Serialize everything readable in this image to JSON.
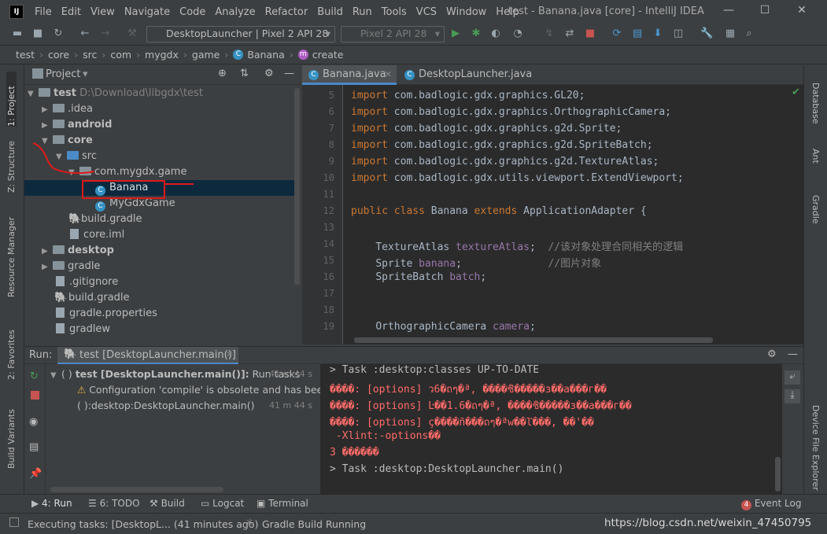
{
  "window": {
    "title": "test - Banana.java [core] - IntelliJ IDEA",
    "menu": [
      "File",
      "Edit",
      "View",
      "Navigate",
      "Code",
      "Analyze",
      "Refactor",
      "Build",
      "Run",
      "Tools",
      "VCS",
      "Window",
      "Help"
    ]
  },
  "toolbar": {
    "run_config": "DesktopLauncher | Pixel 2 API 28",
    "device": "Pixel 2 API 28"
  },
  "breadcrumb": [
    "test",
    "core",
    "src",
    "com",
    "mygdx",
    "game",
    "Banana",
    "create"
  ],
  "left_strip": [
    "1: Project",
    "Z: Structure",
    "Resource Manager",
    "2: Favorites",
    "Build Variants"
  ],
  "right_strip": [
    "Database",
    "Ant",
    "Gradle",
    "Device File Explorer"
  ],
  "project": {
    "header": "Project",
    "tree": [
      {
        "label": "test",
        "extra": "D:\\Download\\libgdx\\test"
      },
      {
        "label": ".idea"
      },
      {
        "label": "android"
      },
      {
        "label": "core"
      },
      {
        "label": "src"
      },
      {
        "label": "com.mygdx.game"
      },
      {
        "label": "Banana"
      },
      {
        "label": "MyGdxGame"
      },
      {
        "label": "build.gradle"
      },
      {
        "label": "core.iml"
      },
      {
        "label": "desktop"
      },
      {
        "label": "gradle"
      },
      {
        "label": ".gitignore"
      },
      {
        "label": "build.gradle"
      },
      {
        "label": "gradle.properties"
      },
      {
        "label": "gradlew"
      }
    ]
  },
  "editor": {
    "tabs": [
      "Banana.java",
      "DesktopLauncher.java"
    ],
    "line_numbers": [
      "5",
      "6",
      "7",
      "8",
      "9",
      "10",
      "11",
      "12",
      "13",
      "14",
      "15",
      "16",
      "17",
      "18",
      "19"
    ],
    "lines": [
      {
        "kw": "import ",
        "rest": "com.badlogic.gdx.graphics.GL20;"
      },
      {
        "kw": "import ",
        "rest": "com.badlogic.gdx.graphics.OrthographicCamera;"
      },
      {
        "kw": "import ",
        "rest": "com.badlogic.gdx.graphics.g2d.Sprite;"
      },
      {
        "kw": "import ",
        "rest": "com.badlogic.gdx.graphics.g2d.SpriteBatch;"
      },
      {
        "kw": "import ",
        "rest": "com.badlogic.gdx.graphics.g2d.TextureAtlas;"
      },
      {
        "kw": "import ",
        "rest": "com.badlogic.gdx.utils.viewport.ExtendViewport;"
      },
      {
        "kw": "",
        "rest": ""
      },
      {
        "kw": "public class ",
        "name": "Banana ",
        "kw2": "extends ",
        "rest": "ApplicationAdapter {"
      },
      {
        "kw": "",
        "rest": ""
      },
      {
        "type": "TextureAtlas ",
        "field": "textureAtlas",
        "rest": ";  ",
        "comment": "//该对象处理合同相关的逻辑"
      },
      {
        "type": "Sprite ",
        "field": "banana",
        "rest": ";              ",
        "comment": "//图片对象"
      },
      {
        "type": "SpriteBatch ",
        "field": "batch",
        "rest": ";",
        "comment": ""
      },
      {
        "kw": "",
        "rest": ""
      },
      {
        "kw": "",
        "rest": ""
      },
      {
        "type": "OrthographicCamera ",
        "field": "camera",
        "rest": ";",
        "comment": ""
      }
    ]
  },
  "run": {
    "label": "Run:",
    "tab": "test [DesktopLauncher.main()]",
    "tree": [
      {
        "bold": "test [DesktopLauncher.main()]:",
        "text": " Run tasks",
        "time": "41 m 44 s"
      },
      {
        "text": "Configuration 'compile' is obsolete and has been",
        "time": ""
      },
      {
        "text": ":desktop:DesktopLauncher.main()",
        "time": "41 m 44 s"
      }
    ],
    "console": [
      {
        "cls": "out",
        "text": "> Task :desktop:classes UP-TO-DATE"
      },
      {
        "cls": "err",
        "text": "����: [options] ว6�ถๆ�ª, ����ชิ�����з��а���г��"
      },
      {
        "cls": "err",
        "text": "����: [options] Ŀ��1.6�ถๆ�ª, ����ชิ�����з��а���г��"
      },
      {
        "cls": "err",
        "text": "����: [options] ç����ñ���ถๆ�ªw��ľ���, ��'��"
      },
      {
        "cls": "err",
        "text": " -Xlint:-options��"
      },
      {
        "cls": "err",
        "text": "3 ������"
      },
      {
        "cls": "out",
        "text": "> Task :desktop:DesktopLauncher.main()"
      }
    ]
  },
  "bottom_tabs": [
    "4: Run",
    "6: TODO",
    "Build",
    "Logcat",
    "Terminal"
  ],
  "event_log": {
    "count": "4",
    "label": "Event Log"
  },
  "status": {
    "left": "Executing tasks: [DesktopL... (41 minutes ago)",
    "center": "Gradle Build Running",
    "right": "https://blog.csdn.net/weixin_47450795"
  }
}
